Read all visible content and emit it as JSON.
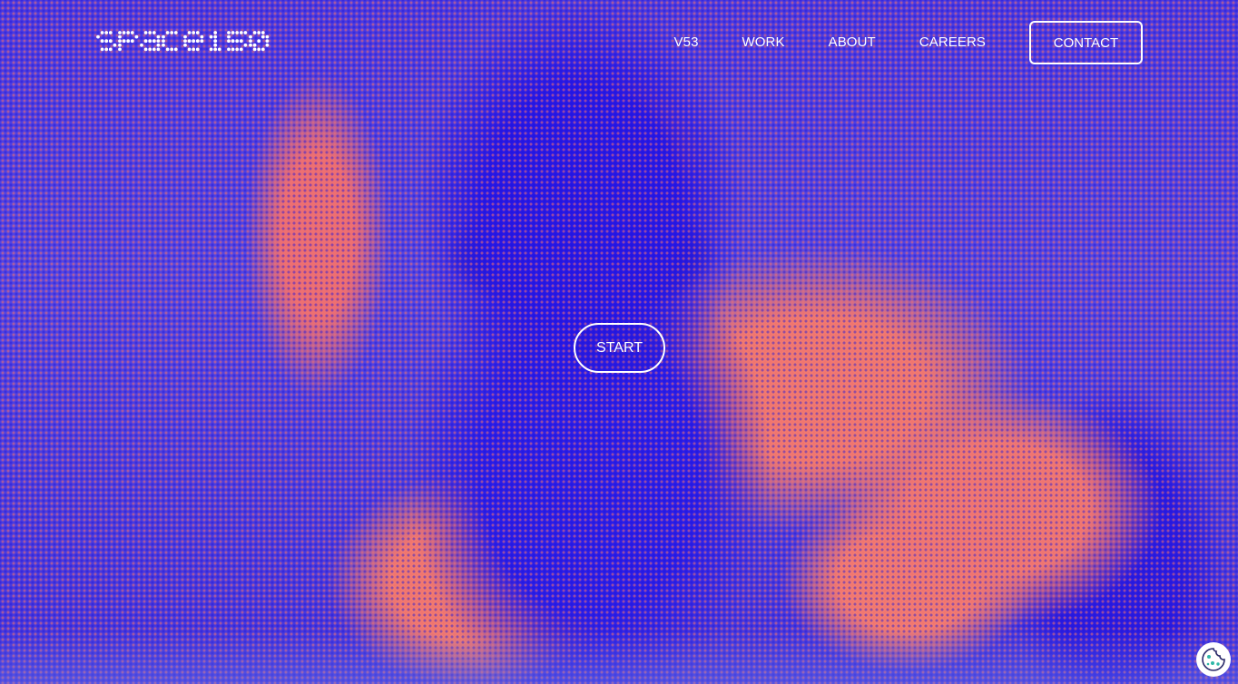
{
  "brand": {
    "logo_alt": "space150"
  },
  "nav": {
    "items": [
      {
        "label": "V53"
      },
      {
        "label": "WORK"
      },
      {
        "label": "ABOUT"
      },
      {
        "label": "CAREERS"
      }
    ],
    "contact_label": "CONTACT"
  },
  "hero": {
    "start_label": "START"
  },
  "colors": {
    "blue": "#2718e6",
    "coral": "#f07070",
    "white": "#ffffff",
    "cookie_accent": "#2fb8a8"
  },
  "icons": {
    "cookie": "cookie-icon"
  }
}
